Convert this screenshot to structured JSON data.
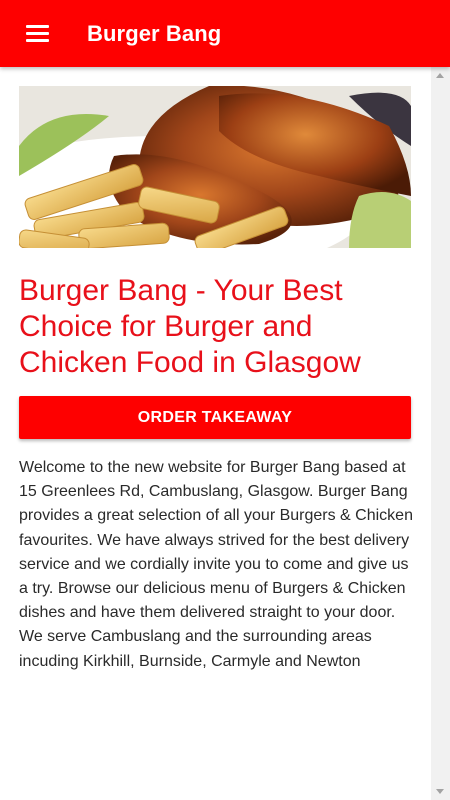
{
  "app_bar": {
    "title": "Burger Bang",
    "menu_icon": "hamburger-menu-icon",
    "color": "#fe0000"
  },
  "hero_image": {
    "subject": "roast chicken legs with chips"
  },
  "main": {
    "headline": "Burger Bang - Your Best Choice for Burger and Chicken Food in Glasgow",
    "order_button_label": "ORDER TAKEAWAY",
    "intro": "Welcome to the new website for Burger Bang based at 15 Greenlees Rd, Cambuslang, Glasgow. Burger Bang provides a great selection of all your Burgers & Chicken favourites. We have always strived for the best delivery service and we cordially invite you to come and give us a try. Browse our delicious menu of Burgers & Chicken dishes and have them delivered straight to your door. We serve Cambuslang and the surrounding areas incuding Kirkhill, Burnside, Carmyle and Newton"
  },
  "colors": {
    "accent": "#fe0000",
    "headline": "#e8101a",
    "body_text": "#2a2a2a"
  }
}
